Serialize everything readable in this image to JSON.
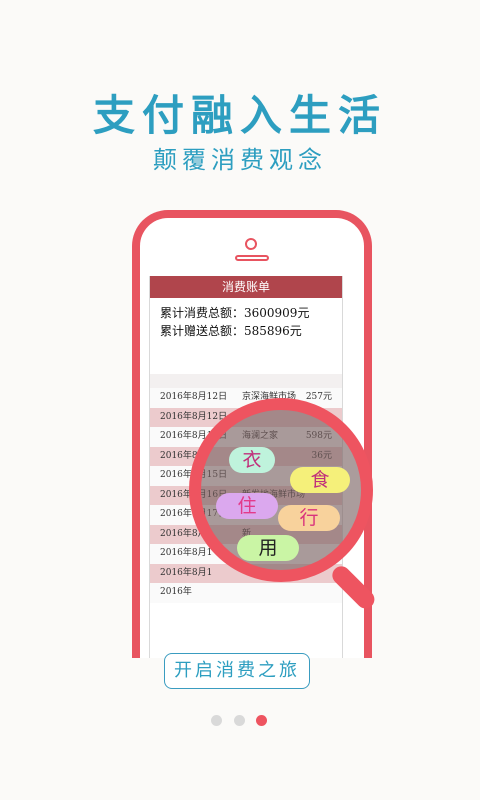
{
  "headline": "支付融入生活",
  "subheadline": "颠覆消费观念",
  "screen": {
    "title": "消费账单",
    "total_spent_label": "累计消费总额：3600909元",
    "total_bonus_label": "累计赠送总额：585896元",
    "rows": [
      {
        "date": "2016年8月12日",
        "store": "京深海鲜市场",
        "amount": "257元"
      },
      {
        "date": "2016年8月12日",
        "store": "",
        "amount": ""
      },
      {
        "date": "2016年8月13日",
        "store": "海澜之家",
        "amount": "598元"
      },
      {
        "date": "2016年8月",
        "store": "",
        "amount": "36元"
      },
      {
        "date": "2016年8月15日",
        "store": "",
        "amount": ""
      },
      {
        "date": "2016年8月16日",
        "store": "新发地海鲜市场",
        "amount": ""
      },
      {
        "date": "2016年8月17日",
        "store": "",
        "amount": ""
      },
      {
        "date": "2016年8月",
        "store": "新",
        "amount": ""
      },
      {
        "date": "2016年8月1",
        "store": "",
        "amount": ""
      },
      {
        "date": "2016年8月1",
        "store": "",
        "amount": ""
      },
      {
        "date": "2016年",
        "store": "",
        "amount": ""
      }
    ]
  },
  "tags": {
    "clothing": "衣",
    "food": "食",
    "housing": "住",
    "travel": "行",
    "goods": "用"
  },
  "cta_label": "开启消费之旅",
  "pager": {
    "count": 3,
    "active_index": 2
  },
  "colors": {
    "accent_blue": "#2d9ec0",
    "phone_red": "#e85460",
    "header_red": "#b0454c",
    "dot_inactive": "#d9d9d9",
    "dot_active": "#ee5460"
  }
}
